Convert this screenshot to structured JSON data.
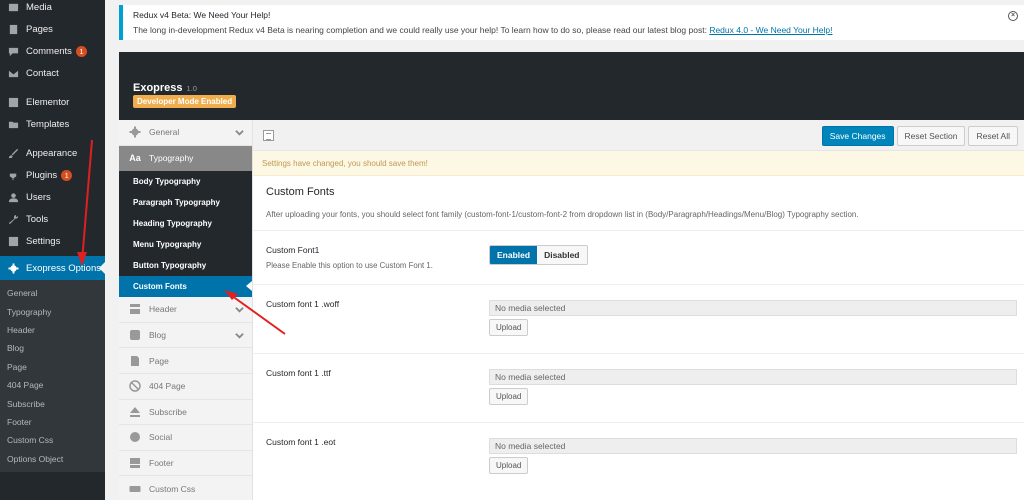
{
  "wp_menu": {
    "media": "Media",
    "pages": "Pages",
    "comments": "Comments",
    "comments_badge": "1",
    "contact": "Contact",
    "elementor": "Elementor",
    "templates": "Templates",
    "appearance": "Appearance",
    "plugins": "Plugins",
    "plugins_badge": "1",
    "users": "Users",
    "tools": "Tools",
    "settings": "Settings",
    "exopress_options": "Exopress Options"
  },
  "wp_submenu": [
    "General",
    "Typography",
    "Header",
    "Blog",
    "Page",
    "404 Page",
    "Subscribe",
    "Footer",
    "Custom Css",
    "Options Object"
  ],
  "notice": {
    "title": "Redux v4 Beta: We Need Your Help!",
    "text": "The long in-development Redux v4 Beta is nearing completion and we could really use your help! To learn how to do so, please read our latest blog post: ",
    "link": "Redux 4.0 - We Need Your Help!"
  },
  "redux_header": {
    "title": "Exopress",
    "version": "1.0",
    "dev_badge": "Developer Mode Enabled"
  },
  "redux_nav": {
    "general": "General",
    "typography": "Typography",
    "typography_subs": [
      "Body Typography",
      "Paragraph Typography",
      "Heading Typography",
      "Menu Typography",
      "Button Typography",
      "Custom Fonts"
    ],
    "header": "Header",
    "blog": "Blog",
    "page": "Page",
    "page_404": "404 Page",
    "subscribe": "Subscribe",
    "social": "Social",
    "footer": "Footer",
    "custom_css": "Custom Css"
  },
  "toolbar": {
    "save": "Save Changes",
    "reset_section": "Reset Section",
    "reset_all": "Reset All"
  },
  "warning": "Settings have changed, you should save them!",
  "section": {
    "title": "Custom Fonts",
    "desc": "After uploading your fonts, you should select font family (custom-font-1/custom-font-2 from dropdown list in (Body/Paragraph/Headings/Menu/Blog) Typography section."
  },
  "fields": {
    "font1_label": "Custom Font1",
    "font1_help": "Please Enable this option to use Custom Font 1.",
    "enabled": "Enabled",
    "disabled": "Disabled",
    "woff_label": "Custom font 1 .woff",
    "ttf_label": "Custom font 1 .ttf",
    "eot_label": "Custom font 1 .eot",
    "no_media": "No media selected",
    "upload": "Upload"
  },
  "colors": {
    "wp_sidebar": "#23282d",
    "wp_active": "#0073aa",
    "dev_badge": "#f0ad4e",
    "annotation_arrow": "#e02020"
  }
}
